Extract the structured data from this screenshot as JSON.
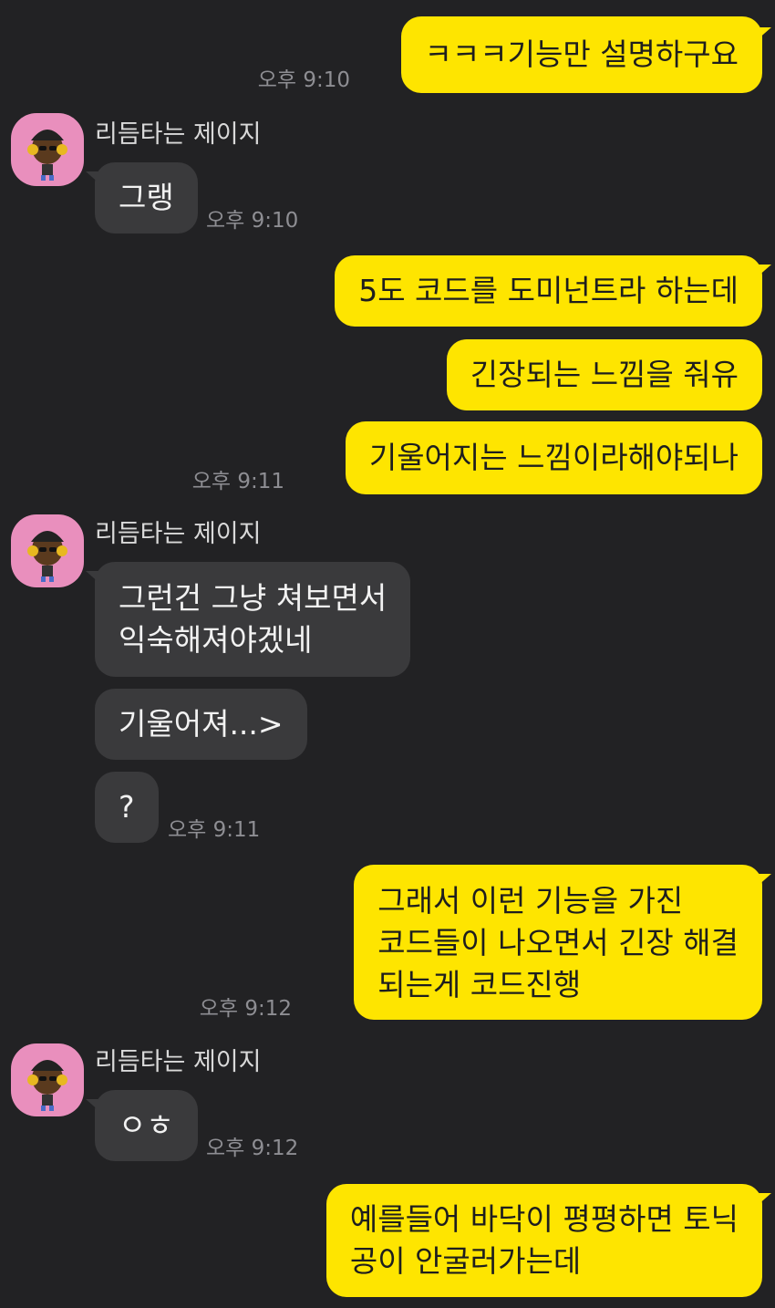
{
  "chat": {
    "contact_name": "리듬타는 제이지",
    "colors": {
      "background": "#222224",
      "my_bubble": "#FEE500",
      "their_bubble": "#3a3a3c"
    },
    "messages": [
      {
        "sender": "me",
        "lines": [
          "ㅋㅋㅋ기능만 설명하구요"
        ],
        "time": "오후 9:10"
      },
      {
        "sender": "contact",
        "lines": [
          "그랭"
        ],
        "time": "오후 9:10"
      },
      {
        "sender": "me",
        "lines": [
          "5도 코드를 도미넌트라 하는데"
        ]
      },
      {
        "sender": "me",
        "lines": [
          "긴장되는 느낌을 줘유"
        ]
      },
      {
        "sender": "me",
        "lines": [
          "기울어지는 느낌이라해야되나"
        ],
        "time": "오후 9:11"
      },
      {
        "sender": "contact",
        "lines": [
          "그런건 그냥 쳐보면서",
          "익숙해져야겠네"
        ]
      },
      {
        "sender": "contact",
        "lines": [
          "기울어져...>"
        ]
      },
      {
        "sender": "contact",
        "lines": [
          "?"
        ],
        "time": "오후 9:11"
      },
      {
        "sender": "me",
        "lines": [
          "그래서 이런 기능을 가진",
          "코드들이 나오면서 긴장 해결",
          "되는게 코드진행"
        ],
        "time": "오후 9:12"
      },
      {
        "sender": "contact",
        "lines": [
          "ㅇㅎ"
        ],
        "time": "오후 9:12"
      },
      {
        "sender": "me",
        "lines": [
          "예를들어 바닥이 평평하면 토닉",
          "공이 안굴러가는데"
        ]
      }
    ]
  }
}
